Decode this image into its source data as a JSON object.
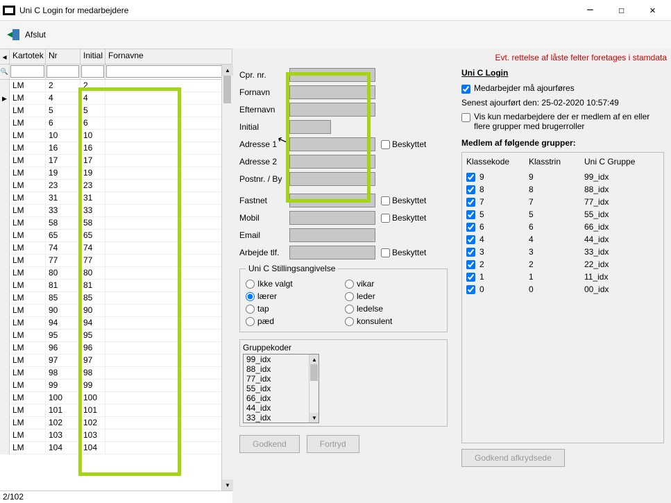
{
  "window": {
    "title": "Uni C Login for medarbejdere"
  },
  "toolbar": {
    "exit_label": "Afslut"
  },
  "grid": {
    "headers": {
      "kartotek": "Kartotek",
      "nr": "Nr",
      "initial": "Initial",
      "fornavne": "Fornavne"
    },
    "rows": [
      {
        "k": "LM",
        "n": "2",
        "i": "2"
      },
      {
        "k": "LM",
        "n": "4",
        "i": "4",
        "active": true
      },
      {
        "k": "LM",
        "n": "5",
        "i": "5"
      },
      {
        "k": "LM",
        "n": "6",
        "i": "6"
      },
      {
        "k": "LM",
        "n": "10",
        "i": "10"
      },
      {
        "k": "LM",
        "n": "16",
        "i": "16"
      },
      {
        "k": "LM",
        "n": "17",
        "i": "17"
      },
      {
        "k": "LM",
        "n": "19",
        "i": "19"
      },
      {
        "k": "LM",
        "n": "23",
        "i": "23"
      },
      {
        "k": "LM",
        "n": "31",
        "i": "31"
      },
      {
        "k": "LM",
        "n": "33",
        "i": "33"
      },
      {
        "k": "LM",
        "n": "58",
        "i": "58"
      },
      {
        "k": "LM",
        "n": "65",
        "i": "65"
      },
      {
        "k": "LM",
        "n": "74",
        "i": "74"
      },
      {
        "k": "LM",
        "n": "77",
        "i": "77"
      },
      {
        "k": "LM",
        "n": "80",
        "i": "80"
      },
      {
        "k": "LM",
        "n": "81",
        "i": "81"
      },
      {
        "k": "LM",
        "n": "85",
        "i": "85"
      },
      {
        "k": "LM",
        "n": "90",
        "i": "90"
      },
      {
        "k": "LM",
        "n": "94",
        "i": "94"
      },
      {
        "k": "LM",
        "n": "95",
        "i": "95"
      },
      {
        "k": "LM",
        "n": "96",
        "i": "96"
      },
      {
        "k": "LM",
        "n": "97",
        "i": "97"
      },
      {
        "k": "LM",
        "n": "98",
        "i": "98"
      },
      {
        "k": "LM",
        "n": "99",
        "i": "99"
      },
      {
        "k": "LM",
        "n": "100",
        "i": "100"
      },
      {
        "k": "LM",
        "n": "101",
        "i": "101"
      },
      {
        "k": "LM",
        "n": "102",
        "i": "102"
      },
      {
        "k": "LM",
        "n": "103",
        "i": "103"
      },
      {
        "k": "LM",
        "n": "104",
        "i": "104"
      }
    ],
    "counter": "2/102"
  },
  "form": {
    "labels": {
      "cpr": "Cpr. nr.",
      "fornavn": "Fornavn",
      "efternavn": "Efternavn",
      "initial": "Initial",
      "adresse1": "Adresse 1",
      "adresse2": "Adresse 2",
      "postnr": "Postnr. / By",
      "fastnet": "Fastnet",
      "mobil": "Mobil",
      "email": "Email",
      "arbejde": "Arbejde tlf."
    },
    "beskyttet": "Beskyttet",
    "stilling": {
      "legend": "Uni C Stillingsangivelse",
      "options": {
        "ikke_valgt": "Ikke valgt",
        "vikar": "vikar",
        "laerer": "lærer",
        "leder": "leder",
        "tap": "tap",
        "ledelse": "ledelse",
        "paed": "pæd",
        "konsulent": "konsulent"
      },
      "selected": "laerer"
    },
    "gruppekoder": {
      "label": "Gruppekoder",
      "items": [
        "99_idx",
        "88_idx",
        "77_idx",
        "55_idx",
        "66_idx",
        "44_idx",
        "33_idx"
      ]
    },
    "buttons": {
      "godkend": "Godkend",
      "fortryd": "Fortryd"
    }
  },
  "side": {
    "red_note": "Evt. rettelse af låste felter foretages i stamdata",
    "heading": "Uni C Login",
    "ajourfoeres": "Medarbejder må ajourføres",
    "senest": "Senest ajourført den:  25-02-2020 10:57:49",
    "vis_kun": "Vis kun medarbejdere der er medlem af en eller flere grupper med brugerroller",
    "groups_title": "Medlem af følgende grupper:",
    "groups_headers": {
      "klassekode": "Klassekode",
      "klasstrin": "Klasstrin",
      "gruppe": "Uni C Gruppe"
    },
    "groups": [
      {
        "checked": true,
        "kode": "9",
        "trin": "9",
        "gruppe": "99_idx"
      },
      {
        "checked": true,
        "kode": "8",
        "trin": "8",
        "gruppe": "88_idx"
      },
      {
        "checked": true,
        "kode": "7",
        "trin": "7",
        "gruppe": "77_idx"
      },
      {
        "checked": true,
        "kode": "5",
        "trin": "5",
        "gruppe": "55_idx"
      },
      {
        "checked": true,
        "kode": "6",
        "trin": "6",
        "gruppe": "66_idx"
      },
      {
        "checked": true,
        "kode": "4",
        "trin": "4",
        "gruppe": "44_idx"
      },
      {
        "checked": true,
        "kode": "3",
        "trin": "3",
        "gruppe": "33_idx"
      },
      {
        "checked": true,
        "kode": "2",
        "trin": "2",
        "gruppe": "22_idx"
      },
      {
        "checked": true,
        "kode": "1",
        "trin": "1",
        "gruppe": "11_idx"
      },
      {
        "checked": true,
        "kode": "0",
        "trin": "0",
        "gruppe": "00_idx"
      }
    ],
    "approve": "Godkend afkrydsede"
  }
}
